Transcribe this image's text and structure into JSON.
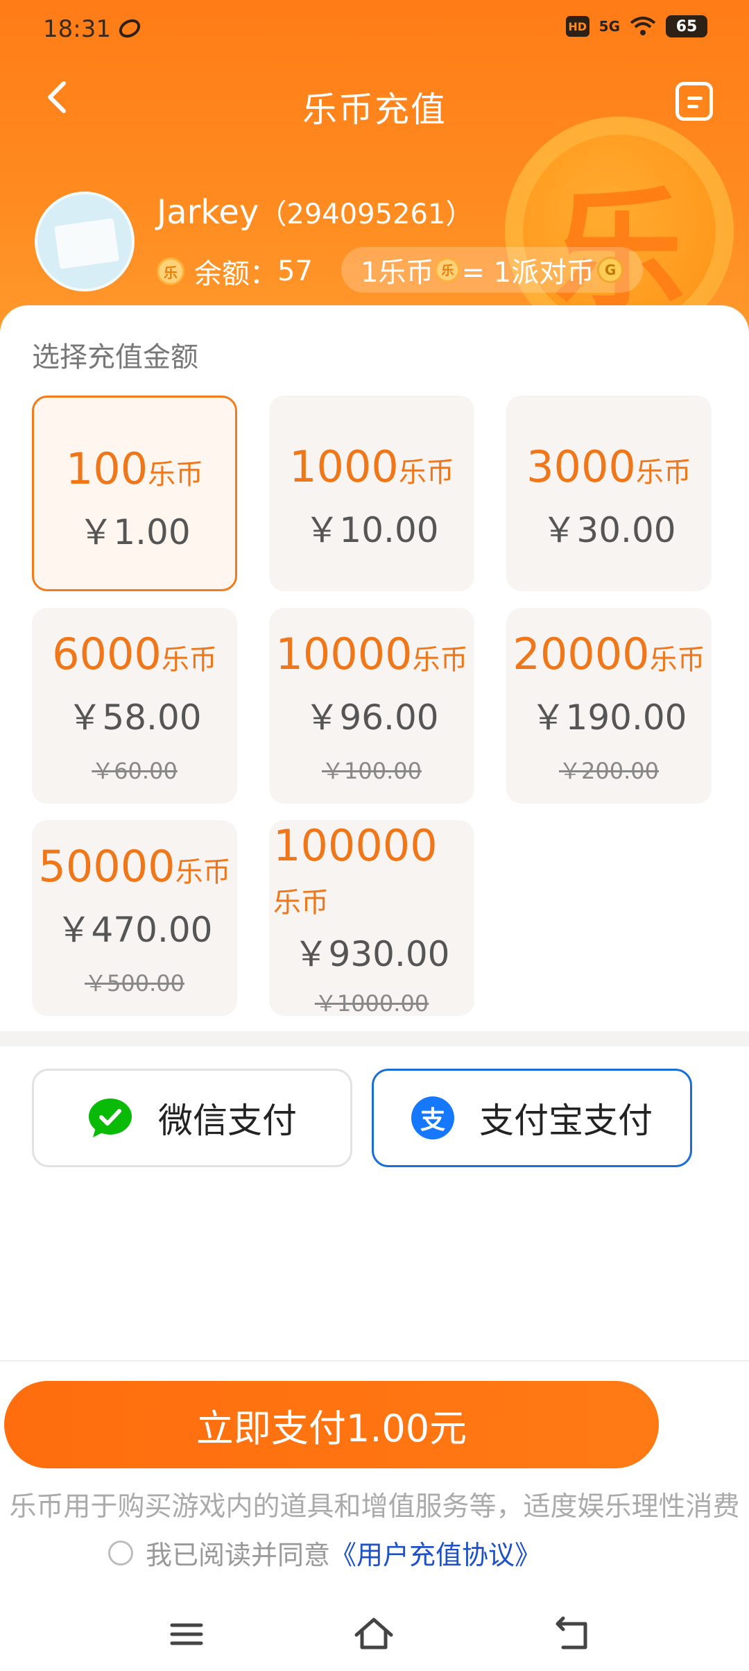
{
  "status_bar": {
    "time": "18:31",
    "hd": "HD",
    "network": "5G",
    "battery": "65"
  },
  "nav": {
    "title": "乐币充值"
  },
  "user": {
    "name": "Jarkey",
    "id": "（294095261）"
  },
  "balance": {
    "label": "余额：",
    "value": "57",
    "coin_glyph": "乐"
  },
  "rate": {
    "left": "1乐币",
    "middle": " = 1派对币"
  },
  "section": {
    "title": "选择充值金额"
  },
  "packages": [
    {
      "coins": "100",
      "unit": "乐币",
      "price": "￥1.00",
      "original": "",
      "selected": true
    },
    {
      "coins": "1000",
      "unit": "乐币",
      "price": "￥10.00",
      "original": "",
      "selected": false
    },
    {
      "coins": "3000",
      "unit": "乐币",
      "price": "￥30.00",
      "original": "",
      "selected": false
    },
    {
      "coins": "6000",
      "unit": "乐币",
      "price": "￥58.00",
      "original": "￥60.00",
      "selected": false
    },
    {
      "coins": "10000",
      "unit": "乐币",
      "price": "￥96.00",
      "original": "￥100.00",
      "selected": false
    },
    {
      "coins": "20000",
      "unit": "乐币",
      "price": "￥190.00",
      "original": "￥200.00",
      "selected": false
    },
    {
      "coins": "50000",
      "unit": "乐币",
      "price": "￥470.00",
      "original": "￥500.00",
      "selected": false
    },
    {
      "coins": "100000",
      "unit": "乐币",
      "price": "￥930.00",
      "original": "￥1000.00",
      "selected": false
    }
  ],
  "payment": {
    "wechat_label": "微信支付",
    "alipay_label": "支付宝支付",
    "alipay_glyph": "支",
    "selected": "alipay"
  },
  "cta": {
    "label": "立即支付1.00元"
  },
  "notice": "乐币用于购买游戏内的道具和增值服务等，适度娱乐理性消费",
  "agreement": {
    "text": "我已阅读并同意",
    "link": "《用户充值协议》",
    "checked": false
  },
  "colors": {
    "brand_orange": "#ff7a14",
    "coin_text": "#f0761a",
    "alipay_blue": "#1677ff",
    "wechat_green": "#09bb07",
    "link_blue": "#1e50c8"
  }
}
